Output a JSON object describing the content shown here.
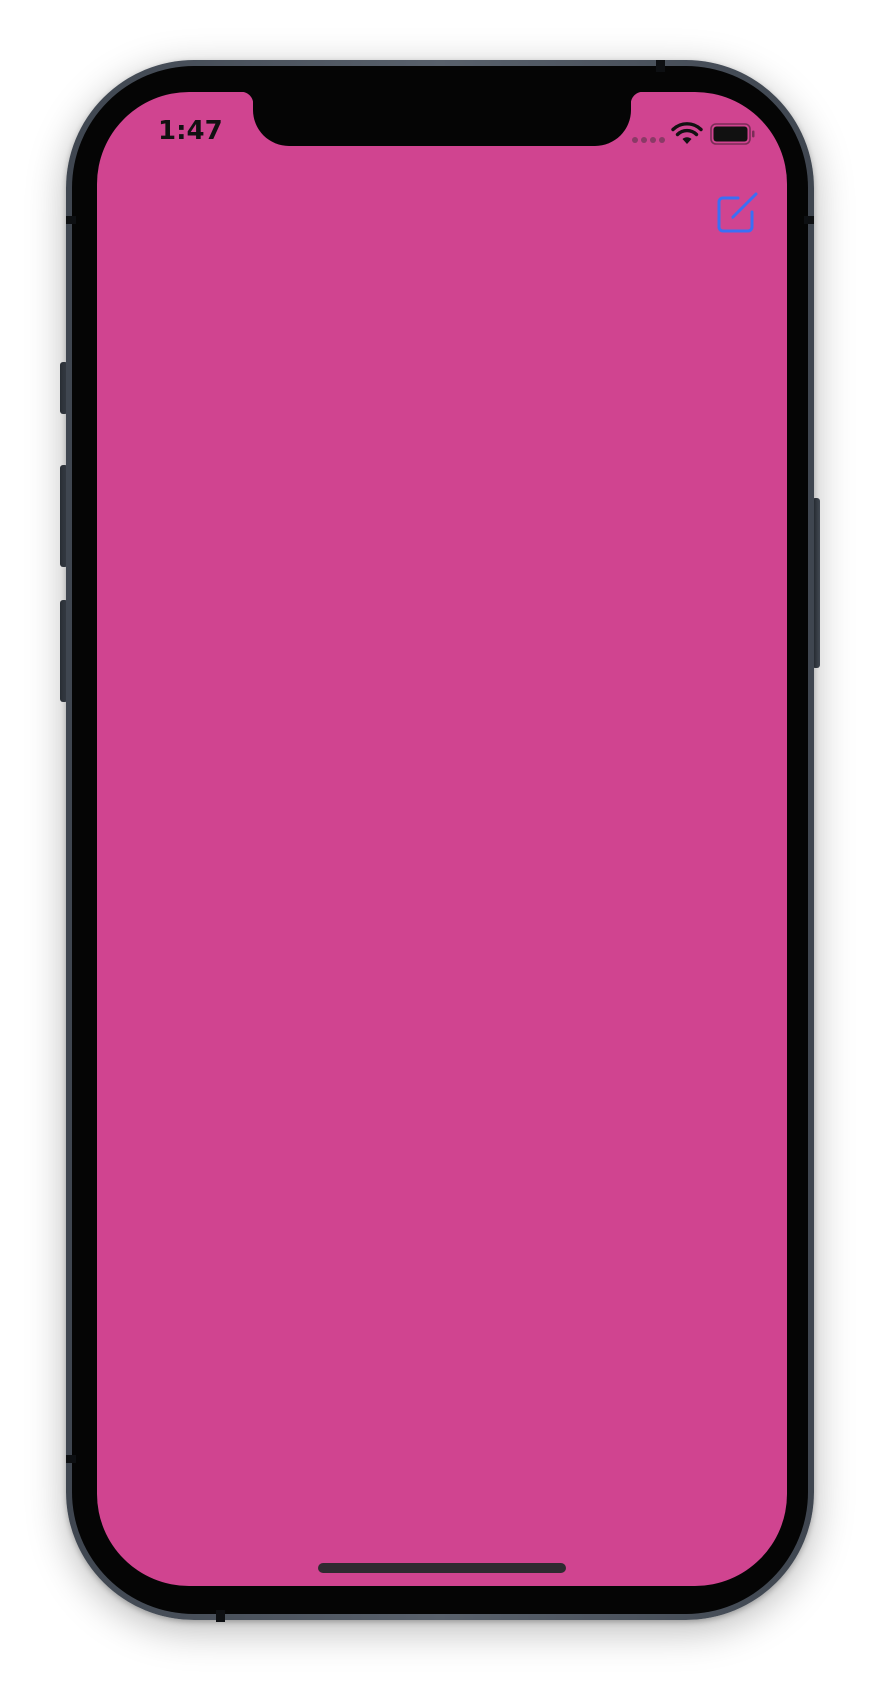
{
  "status_bar": {
    "time": "1:47",
    "wifi_icon": "wifi-icon",
    "battery_icon": "battery-icon",
    "signal_icon": "cellular-signal-icon"
  },
  "navigation": {
    "compose_icon": "compose-icon"
  },
  "colors": {
    "screen_background": "#d04490",
    "accent": "#3b6ff5",
    "status_text": "#111111"
  }
}
